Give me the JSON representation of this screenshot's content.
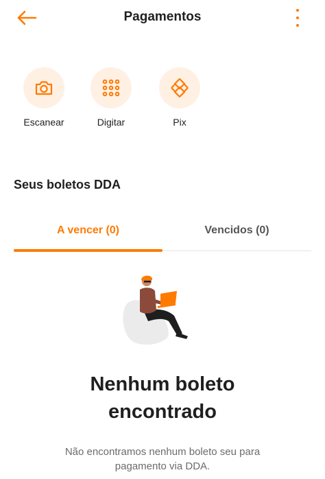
{
  "header": {
    "title": "Pagamentos",
    "back_icon": "arrow-left-icon",
    "menu_icon": "more-vertical-icon"
  },
  "actions": [
    {
      "label": "Escanear",
      "icon": "camera-icon"
    },
    {
      "label": "Digitar",
      "icon": "keypad-icon"
    },
    {
      "label": "Pix",
      "icon": "pix-icon"
    }
  ],
  "dda": {
    "section_title": "Seus boletos DDA",
    "tabs": [
      {
        "label": "A vencer (0)",
        "active": true
      },
      {
        "label": "Vencidos (0)",
        "active": false
      }
    ]
  },
  "empty_state": {
    "title_line1": "Nenhum boleto",
    "title_line2": "encontrado",
    "desc_line1": "Não encontramos nenhum boleto seu para",
    "desc_line2": "pagamento via DDA."
  },
  "colors": {
    "accent": "#ff7a00",
    "icon_bg": "#fff0e4",
    "text": "#1f1f1f",
    "muted": "#6b6b6b"
  }
}
